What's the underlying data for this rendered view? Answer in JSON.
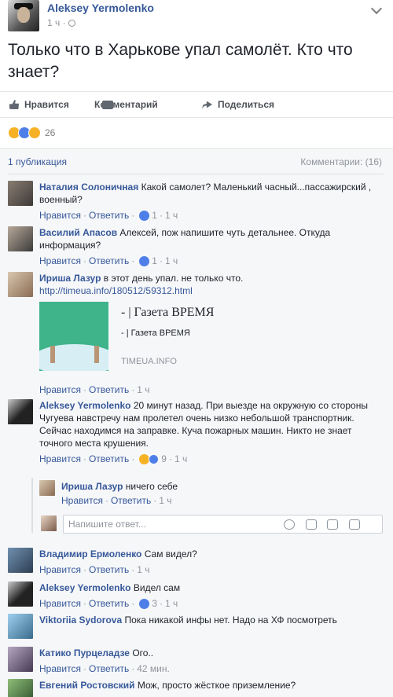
{
  "post": {
    "author": "Aleksey Yermolenko",
    "time": "1 ч",
    "text": "Только что в Харькове упал самолёт. Кто что знает?",
    "actions": {
      "like": "Нравится",
      "comment": "Комментарий",
      "share": "Поделиться"
    },
    "reactions_count": "26",
    "shares": "1 публикация",
    "comments_total": "Комментарии: (16)"
  },
  "comment_labels": {
    "like": "Нравится",
    "reply": "Ответить",
    "dot": "·"
  },
  "comments": [
    {
      "author": "Наталия Солоничная",
      "text": "Какой самолет? Маленький часный...пассажирский , военный?",
      "likes": "1",
      "time": "1 ч"
    },
    {
      "author": "Василий Апасов",
      "text": "Алексей, пож напишите чуть детальнее. Откуда информация?",
      "likes": "1",
      "time": "1 ч"
    },
    {
      "author": "Ириша Лазур",
      "text": "в этот день упал. не только что.",
      "link": "http://timeua.info/180512/59312.html",
      "time": "1 ч",
      "card": {
        "title": "- | Газета ВРЕМЯ",
        "subtitle": "- | Газета ВРЕМЯ",
        "domain": "TIMEUA.INFO"
      }
    },
    {
      "author": "Aleksey Yermolenko",
      "text": "20 минут назад. При выезде на окружную со стороны Чугуева навстречу нам пролетел очень низко небольшой транспортник.",
      "text2": "Сейчас находимся на заправке. Куча пожарных машин. Никто не знает точного места крушения.",
      "likes": "9",
      "time": "1 ч"
    },
    {
      "author": "Ириша Лазур",
      "text": "ничего себе",
      "time": "1 ч"
    },
    {
      "author": "Владимир Ермоленко",
      "text": "Сам видел?",
      "time": "1 ч"
    },
    {
      "author": "Aleksey Yermolenko",
      "text": "Видел сам",
      "likes": "3",
      "time": "1 ч"
    },
    {
      "author": "Viktoriia Sydorova",
      "text": "Пока никакой инфы нет. Надо на ХФ посмотреть"
    },
    {
      "author": "Катико Пурцеладзе",
      "text": "Ого..",
      "time": "42 мин."
    },
    {
      "author": "Евгений Ростовский",
      "text": "Мож, просто жёсткое приземление?"
    }
  ],
  "reply_box": {
    "placeholder": "Напишите ответ..."
  }
}
